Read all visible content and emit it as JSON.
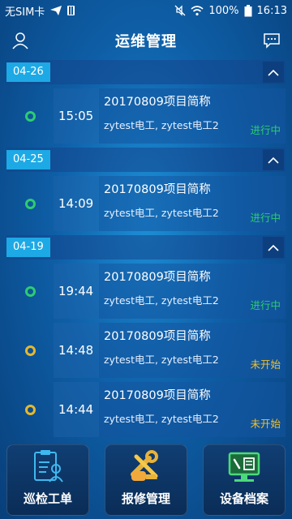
{
  "status_bar": {
    "carrier": "无SIM卡",
    "battery": "100%",
    "time": "16:13"
  },
  "header": {
    "title": "运维管理"
  },
  "groups": [
    {
      "date": "04-26",
      "items": [
        {
          "time": "15:05",
          "name": "20170809项目简称",
          "people": "zytest电工, zytest电工2",
          "status": "进行中",
          "state": "active"
        }
      ]
    },
    {
      "date": "04-25",
      "items": [
        {
          "time": "14:09",
          "name": "20170809项目简称",
          "people": "zytest电工, zytest电工2",
          "status": "进行中",
          "state": "active"
        }
      ]
    },
    {
      "date": "04-19",
      "items": [
        {
          "time": "19:44",
          "name": "20170809项目简称",
          "people": "zytest电工, zytest电工2",
          "status": "进行中",
          "state": "active"
        },
        {
          "time": "14:48",
          "name": "20170809项目简称",
          "people": "zytest电工, zytest电工2",
          "status": "未开始",
          "state": "pending"
        },
        {
          "time": "14:44",
          "name": "20170809项目简称",
          "people": "zytest电工, zytest电工2",
          "status": "未开始",
          "state": "pending"
        }
      ]
    }
  ],
  "bottom_nav": [
    {
      "label": "巡检工单",
      "icon": "inspection-clipboard-icon"
    },
    {
      "label": "报修管理",
      "icon": "repair-tools-icon"
    },
    {
      "label": "设备档案",
      "icon": "equipment-monitor-icon"
    }
  ],
  "colors": {
    "active_status": "#2ecc71",
    "pending_status": "#f0c030",
    "date_tag": "#1da9e5"
  }
}
